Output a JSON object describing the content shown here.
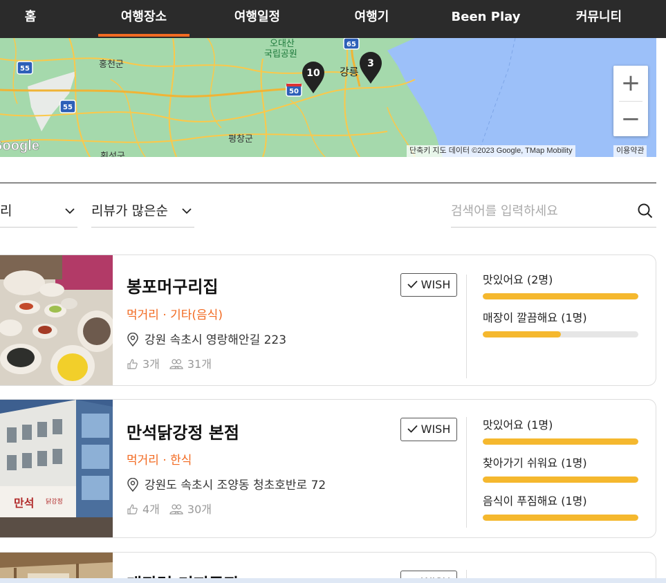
{
  "nav": {
    "items": [
      {
        "label": "홈"
      },
      {
        "label": "여행장소"
      },
      {
        "label": "여행일정"
      },
      {
        "label": "여행기"
      },
      {
        "label": "Been Play"
      },
      {
        "label": "커뮤니티"
      }
    ],
    "active": "여행장소",
    "accent_color": "#f26a21"
  },
  "map": {
    "labels": {
      "hongcheon": "홍천군",
      "odaesan": "오대산",
      "national_park": "국립공원",
      "gangneung": "강릉",
      "pyeongchang": "평창군",
      "hoengseong": "횡성군",
      "google": "Google"
    },
    "route_shields": [
      "55",
      "55",
      "50",
      "65"
    ],
    "markers": [
      {
        "label": "10"
      },
      {
        "label": "3"
      }
    ],
    "zoom_in": "+",
    "zoom_out": "−",
    "attribution": "단축키  지도 데이터 ©2023 Google, TMap Mobility",
    "terms": "이용약관"
  },
  "filters": {
    "region_label": "리",
    "sort_label": "리뷰가 많은순",
    "search_placeholder": "검색어를 입력하세요"
  },
  "places": [
    {
      "name": "봉포머구리집",
      "category": "먹거리 · 기타(음식)",
      "address": "강원 속초시 영랑해안길 223",
      "likes": "3개",
      "visitors": "31개",
      "wish_label": "WISH",
      "reviews": [
        {
          "label": "맛있어요 (2명)",
          "ratio": 1.0
        },
        {
          "label": "매장이 깔끔해요 (1명)",
          "ratio": 0.5
        }
      ]
    },
    {
      "name": "만석닭강정 본점",
      "category": "먹거리 · 한식",
      "address": "강원도 속초시 조양동 청초호반로 72",
      "likes": "4개",
      "visitors": "30개",
      "wish_label": "WISH",
      "reviews": [
        {
          "label": "맛있어요 (1명)",
          "ratio": 1.0
        },
        {
          "label": "찾아가기 쉬워요 (1명)",
          "ratio": 1.0
        },
        {
          "label": "음식이 푸짐해요 (1명)",
          "ratio": 1.0
        }
      ]
    },
    {
      "name": "대관령 커피공장",
      "wish_label": "WISH"
    }
  ],
  "colors": {
    "nav_bg": "#2b2b2b",
    "category": "#f26a21",
    "review_bar": "#f5b82e"
  }
}
